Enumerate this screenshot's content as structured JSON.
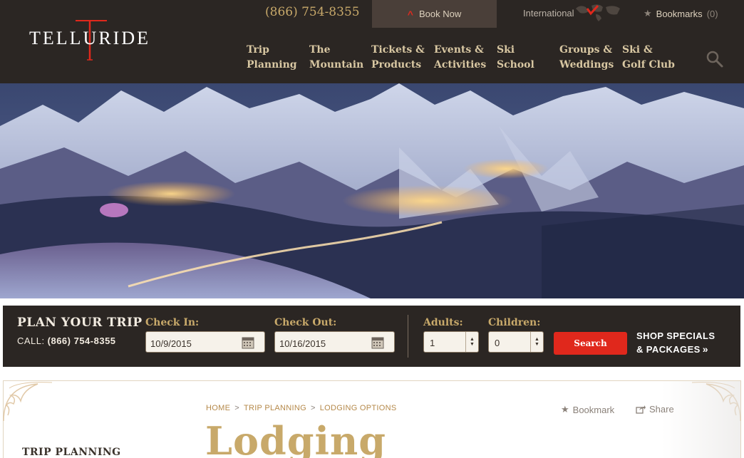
{
  "header": {
    "logo_text": "TELLURIDE",
    "phone": "(866) 754-8355",
    "book_now": "Book Now",
    "international": "International",
    "bookmarks_label": "Bookmarks",
    "bookmarks_count": "(0)",
    "nav": [
      {
        "line1": "Trip",
        "line2": "Planning"
      },
      {
        "line1": "The",
        "line2": "Mountain"
      },
      {
        "line1": "Tickets &",
        "line2": "Products"
      },
      {
        "line1": "Events &",
        "line2": "Activities"
      },
      {
        "line1": "Ski",
        "line2": "School"
      },
      {
        "line1": "Groups &",
        "line2": "Weddings"
      },
      {
        "line1": "Ski &",
        "line2": "Golf Club"
      }
    ]
  },
  "booking": {
    "title": "PLAN YOUR TRIP",
    "call_label": "CALL:",
    "call_number": "(866) 754-8355",
    "check_in_label": "Check In:",
    "check_in_value": "10/9/2015",
    "check_out_label": "Check Out:",
    "check_out_value": "10/16/2015",
    "adults_label": "Adults:",
    "adults_value": "1",
    "children_label": "Children:",
    "children_value": "0",
    "search_label": "Search",
    "specials_line1": "SHOP SPECIALS",
    "specials_line2": "& PACKAGES"
  },
  "content": {
    "breadcrumb": [
      "HOME",
      "TRIP PLANNING",
      "LODGING OPTIONS"
    ],
    "breadcrumb_sep": ">",
    "bookmark_label": "Bookmark",
    "share_label": "Share",
    "page_title": "Lodging",
    "sidebar_title": "TRIP PLANNING"
  },
  "colors": {
    "header_bg": "#2b2623",
    "gold": "#c8a96a",
    "accent_red": "#e0281c"
  }
}
